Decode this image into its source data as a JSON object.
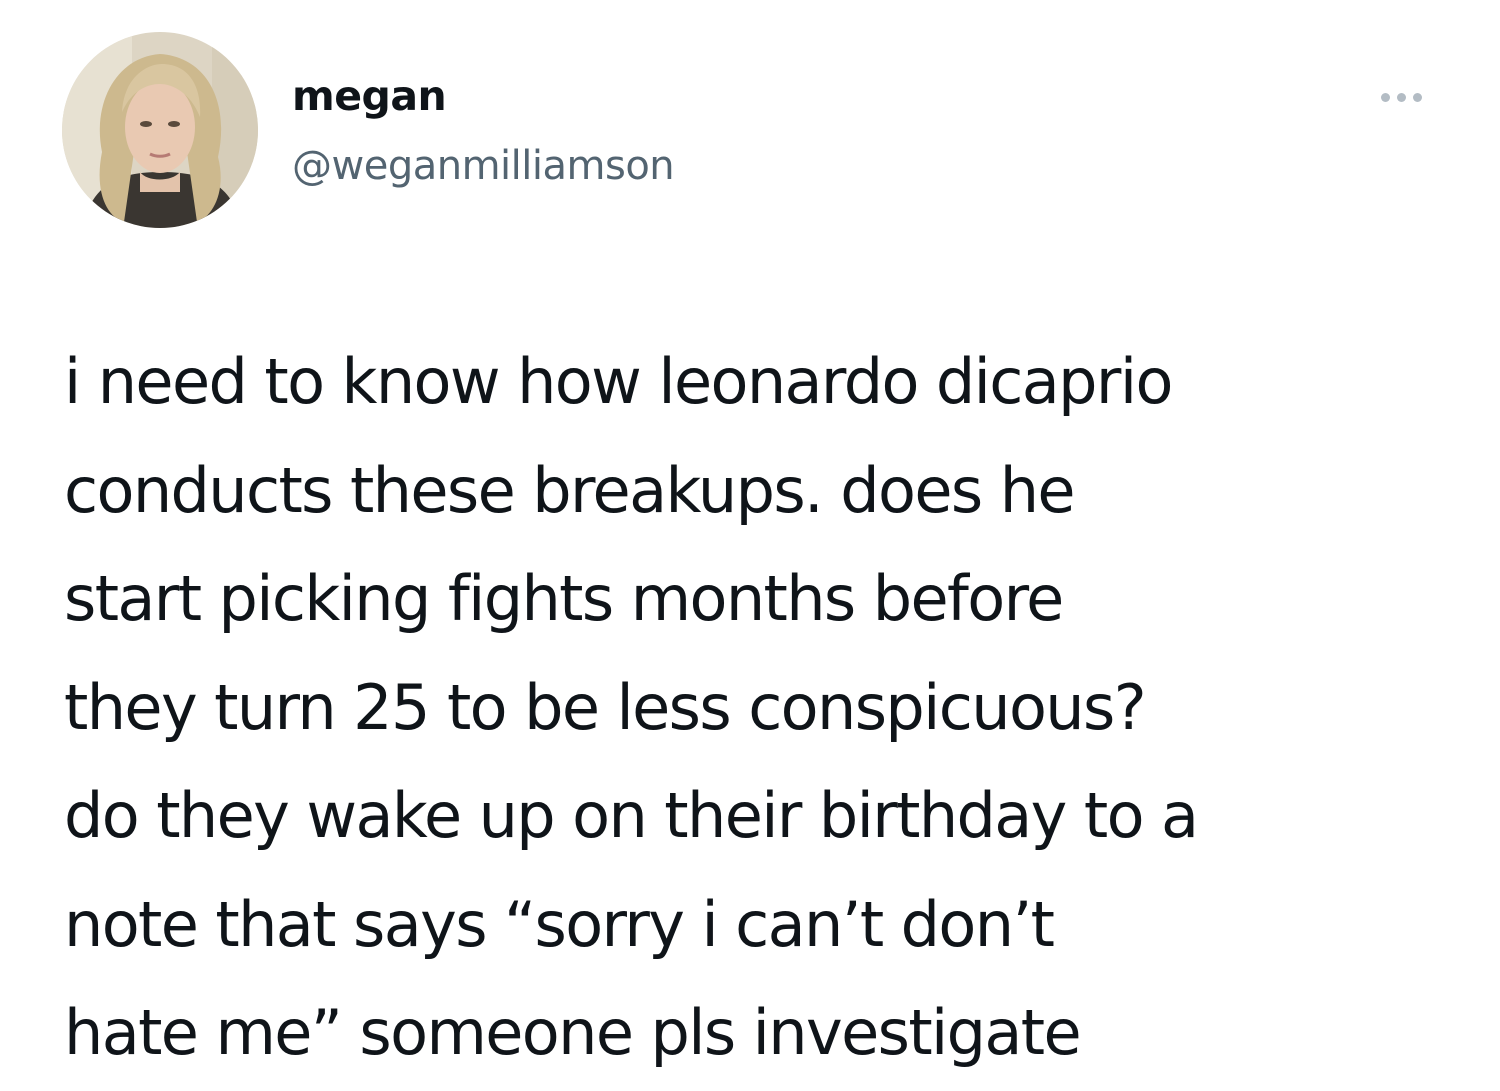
{
  "tweet": {
    "author": {
      "display_name": "megan",
      "handle": "@weganmilliamson",
      "avatar_icon": "profile-photo"
    },
    "more_icon": "more-dots-icon",
    "text_lines": [
      "i need to know how leonardo dicaprio",
      "conducts these breakups. does he",
      "start picking fights months before",
      "they turn 25 to be less conspicuous?",
      "do they wake up on their birthday to a",
      "note that says “sorry i can’t don’t",
      "hate me” someone pls investigate"
    ]
  },
  "colors": {
    "text_primary": "#0f1419",
    "text_secondary": "#536471",
    "background": "#ffffff"
  }
}
